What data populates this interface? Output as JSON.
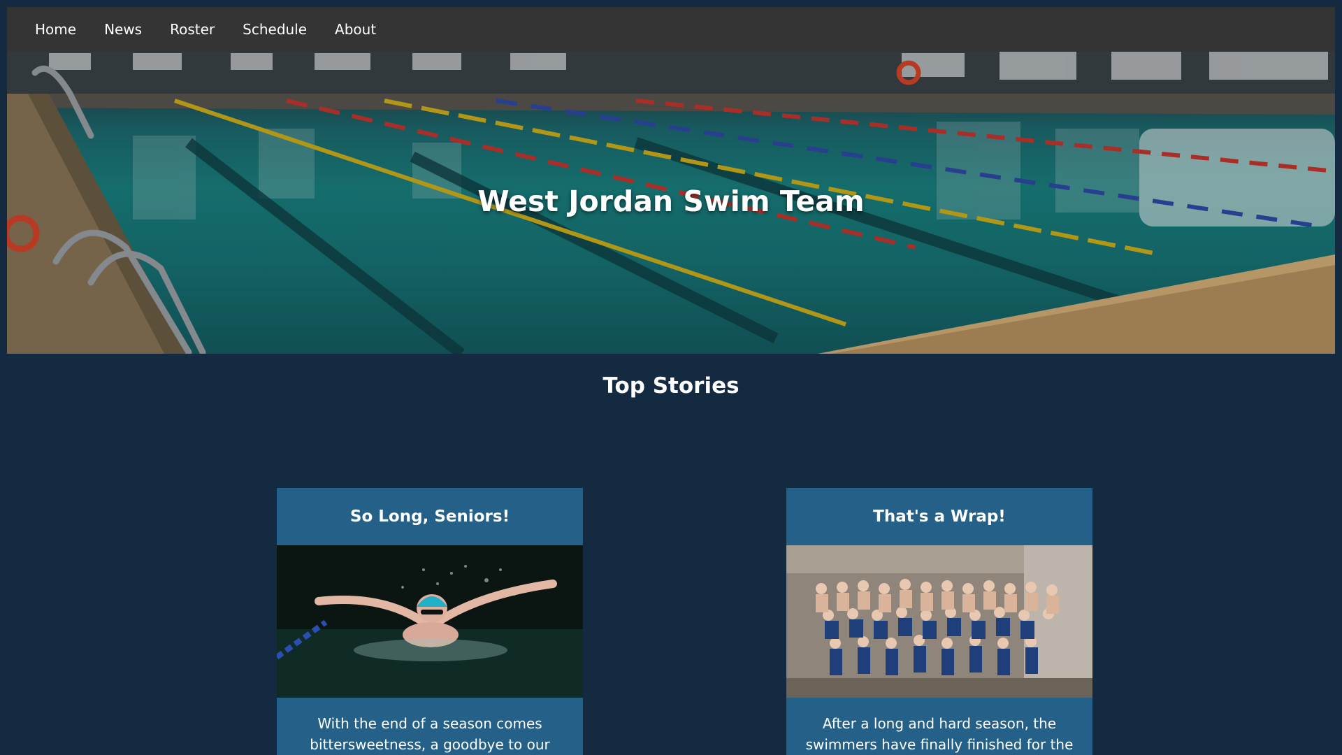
{
  "nav": {
    "items": [
      "Home",
      "News",
      "Roster",
      "Schedule",
      "About"
    ]
  },
  "hero": {
    "title": "West Jordan Swim Team"
  },
  "top_stories": {
    "title": "Top Stories",
    "cards": [
      {
        "title": "So Long, Seniors!",
        "text": "With the end of a season comes bittersweetness, a goodbye to our seniors."
      },
      {
        "title": "That's a Wrap!",
        "text": "After a long and hard season, the swimmers have finally finished for the year"
      }
    ]
  },
  "colors": {
    "page_background": "#142a40",
    "navbar": "#343434",
    "card": "#246087",
    "text": "#ffffff"
  }
}
